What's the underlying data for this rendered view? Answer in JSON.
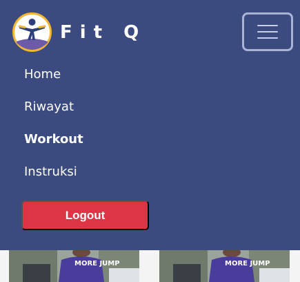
{
  "brand": {
    "name": "Fit Q",
    "logo_icon": "yoga-figure-icon"
  },
  "toggler": {
    "icon": "hamburger-menu-icon"
  },
  "nav": {
    "items": [
      {
        "label": "Home",
        "active": false
      },
      {
        "label": "Riwayat",
        "active": false
      },
      {
        "label": "Workout",
        "active": true
      },
      {
        "label": "Instruksi",
        "active": false
      }
    ]
  },
  "logout": {
    "label": "Logout"
  },
  "colors": {
    "navbar": "#3c4b7f",
    "logout": "#dc3545",
    "logo_ring": "#f2b632",
    "logo_base": "#6d5aa8"
  },
  "cards": [
    {
      "image": "workout-photo-1",
      "shirt_text": "MORE JUMP"
    },
    {
      "image": "workout-photo-2",
      "shirt_text": "MORE JUMP"
    }
  ]
}
